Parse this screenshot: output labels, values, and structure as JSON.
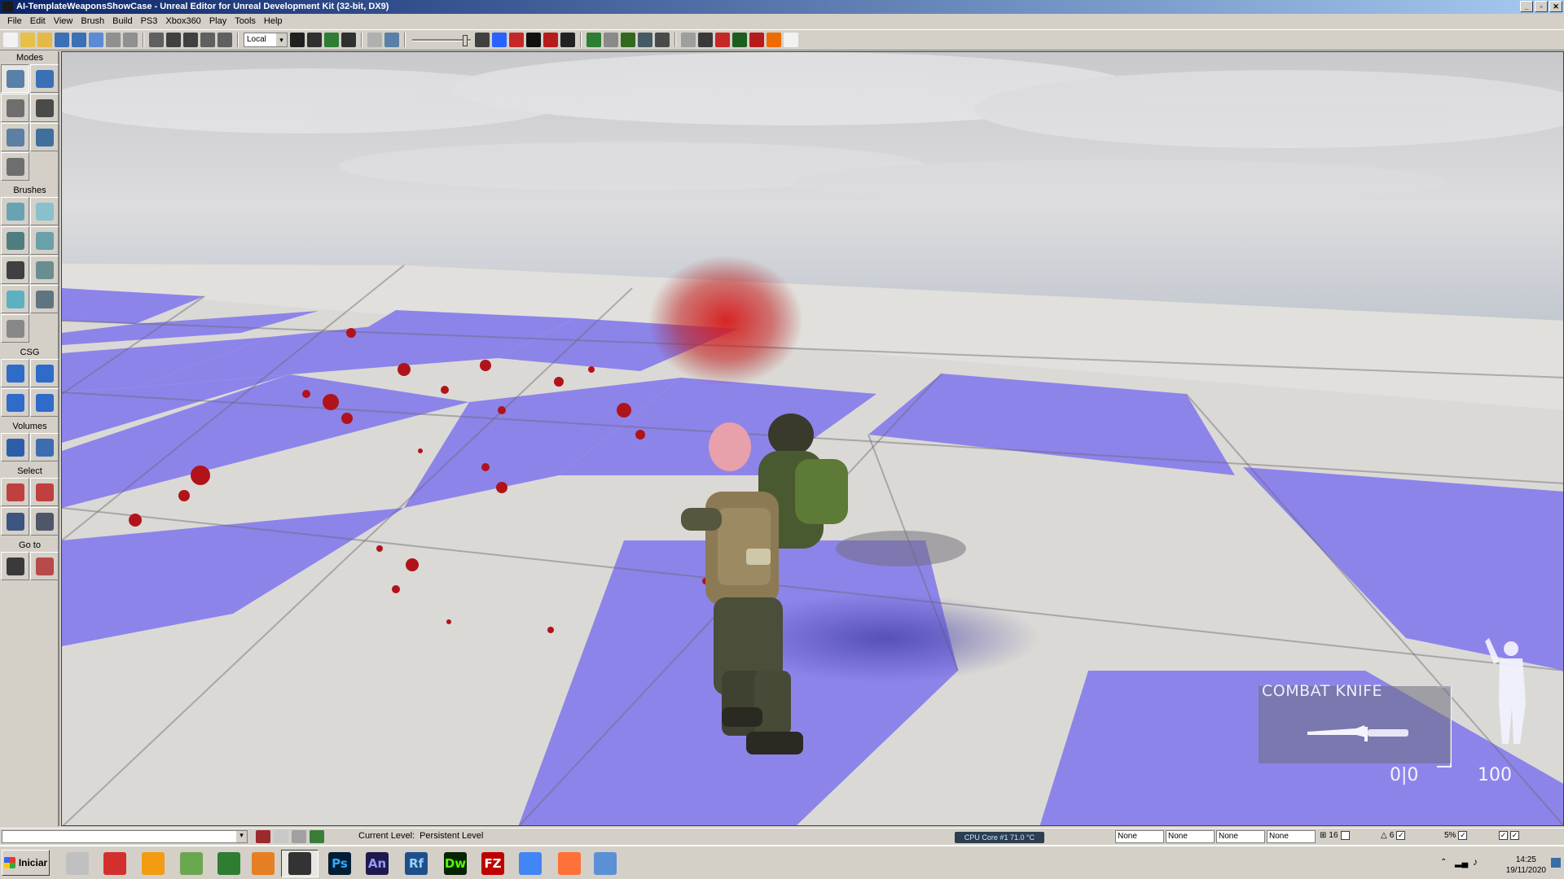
{
  "window": {
    "title": "AI-TemplateWeaponsShowCase - Unreal Editor for Unreal Development Kit (32-bit, DX9)",
    "buttons": [
      "_",
      "▫",
      "✕"
    ]
  },
  "menu": [
    "File",
    "Edit",
    "View",
    "Brush",
    "Build",
    "PS3",
    "Xbox360",
    "Play",
    "Tools",
    "Help"
  ],
  "toolbar": {
    "coord_system": "Local",
    "icons": [
      "new-icon",
      "open-icon",
      "favorite-icon",
      "save-icon",
      "save-all-icon",
      "save-level-icon",
      "undo-icon",
      "redo-icon",
      "select-icon",
      "translate-icon",
      "rotate-icon",
      "scale-icon",
      "scale-nonuniform-icon",
      "find-icon",
      "generic-browser-icon",
      "kismet-icon",
      "matinee-icon",
      "drag-grid-icon",
      "wireframe-icon",
      "brush-wire-icon",
      "lit-icon",
      "unlit-icon",
      "p-icon",
      "lighting-only-icon",
      "detail-icon",
      "build-geometry-icon",
      "build-lighting-icon",
      "build-paths-icon",
      "build-cover-icon",
      "build-all-icon",
      "play-icon",
      "console-icon",
      "light-icon",
      "stop-icon",
      "play-in-editor-icon",
      "play-on-console-icon",
      "orange-square-icon"
    ]
  },
  "modes": {
    "sections": [
      {
        "title": "Modes",
        "buttons": [
          "camera-mode-icon",
          "geometry-mode-icon",
          "terrain-mode-icon",
          "texture-align-icon",
          "mesh-paint-icon",
          "foliage-icon",
          "landscape-icon"
        ]
      },
      {
        "title": "Brushes",
        "buttons": [
          "cube-brush-icon",
          "cone-brush-icon",
          "curved-stair-icon",
          "cylinder-brush-icon",
          "linear-stair-icon",
          "sheet-brush-icon",
          "spiral-stair-icon",
          "sphere-brush-icon",
          "volumetric-brush-icon"
        ]
      },
      {
        "title": "CSG",
        "buttons": [
          "csg-add-icon",
          "csg-subtract-icon",
          "csg-intersect-icon",
          "csg-deintersect-icon"
        ]
      },
      {
        "title": "Volumes",
        "buttons": [
          "add-volume-icon",
          "volume-list-icon"
        ]
      },
      {
        "title": "Select",
        "buttons": [
          "show-selected-icon",
          "hide-selected-icon",
          "invert-selection-icon",
          "show-all-icon"
        ]
      },
      {
        "title": "Go to",
        "buttons": [
          "goto-actor-icon",
          "goto-builder-brush-icon"
        ]
      }
    ]
  },
  "hud": {
    "weapon_name": "COMBAT KNIFE",
    "ammo": "0|0",
    "health": "100"
  },
  "status": {
    "current_level_label": "Current Level:",
    "current_level_value": "Persistent Level",
    "cpu": "CPU Core #1   71.0 °C",
    "fields": [
      "None",
      "None",
      "None",
      "None"
    ],
    "grid_value": "16",
    "rotation_value": "6",
    "scale_value": "5%"
  },
  "taskbar": {
    "start_label": "Iniciar",
    "apps": [
      {
        "name": "speedometer-icon",
        "label": "",
        "color": "#c0c0c0"
      },
      {
        "name": "acrobat-icon",
        "label": "",
        "color": "#d32f2f"
      },
      {
        "name": "media-player-icon",
        "label": "",
        "color": "#f39c12"
      },
      {
        "name": "chart-app-icon",
        "label": "",
        "color": "#6aa84f"
      },
      {
        "name": "monitor-app-icon",
        "label": "",
        "color": "#2e7d32"
      },
      {
        "name": "tools-app-icon",
        "label": "",
        "color": "#e67e22"
      },
      {
        "name": "udk-weapon-icon",
        "label": "",
        "color": "#333333"
      },
      {
        "name": "photoshop-icon",
        "label": "Ps",
        "color": "#001d34"
      },
      {
        "name": "animate-icon",
        "label": "An",
        "color": "#1f1a4d"
      },
      {
        "name": "flash-builder-icon",
        "label": "Rf",
        "color": "#1e4f8a"
      },
      {
        "name": "dreamweaver-icon",
        "label": "Dw",
        "color": "#072401"
      },
      {
        "name": "filezilla-icon",
        "label": "FZ",
        "color": "#bf0000"
      },
      {
        "name": "chrome-icon",
        "label": "",
        "color": "#4285f4"
      },
      {
        "name": "firefox-icon",
        "label": "",
        "color": "#ff7139"
      },
      {
        "name": "network-app-icon",
        "label": "",
        "color": "#5b8fd6"
      }
    ],
    "time": "14:25",
    "date": "19/11/2020"
  },
  "colors": {
    "purple_tile": "#8a80e6",
    "white_tile": "#dcdad6",
    "sky_top": "#c8c8cc",
    "sky_bottom": "#b5bdc7"
  }
}
